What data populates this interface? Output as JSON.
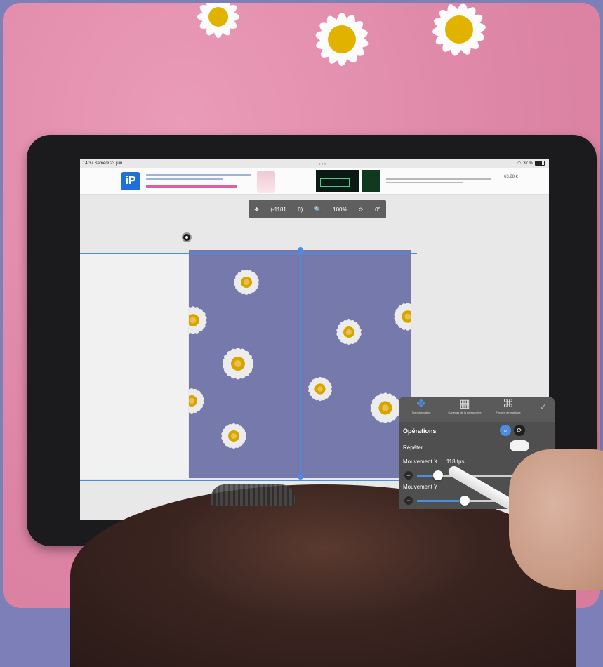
{
  "status_bar": {
    "time": "14:37 Samedi 23 juin",
    "right": "37 %"
  },
  "ad_bar": {
    "logo": "iP",
    "price": "63,28 €"
  },
  "toolbar": {
    "move_label": "(-1181",
    "coord_y": "0)",
    "zoom": "100%",
    "rotation": "0°"
  },
  "panel": {
    "tabs": [
      {
        "label": "Transformation",
        "icon": "move-arrows-icon"
      },
      {
        "label": "Canevas de la perspective",
        "icon": "grid-perspective-icon"
      },
      {
        "label": "Formes de maillage",
        "icon": "mesh-map-icon"
      }
    ],
    "title": "Opérations",
    "repeat_label": "Répéter",
    "repeat_on": true,
    "move_x_label": "Mouvement X",
    "move_x_value": "118 fps",
    "move_x_level": 0.2,
    "move_y_label": "Mouvement Y",
    "move_y_level": 0.45
  },
  "colors": {
    "pattern_bg": "#7679ab",
    "guide_blue": "#4d8de0",
    "table_pink": "#e08aa9"
  }
}
